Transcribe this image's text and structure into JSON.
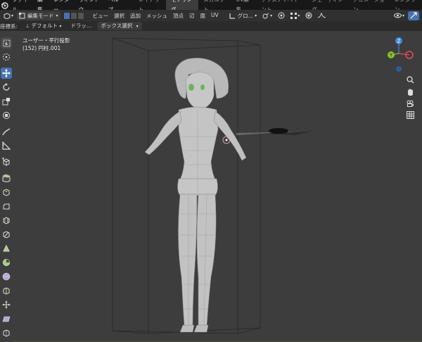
{
  "menu": {
    "items": [
      "ファイル",
      "編集",
      "レンダー",
      "ウィンドウ",
      "ヘルプ"
    ]
  },
  "workspaces": {
    "tabs": [
      "レイアウト",
      "モデリング",
      "スカルプト",
      "UV編集",
      "テクスチャペイント",
      "シェーディング",
      "アニメーション",
      "レンダリン"
    ],
    "active_index": 1
  },
  "header": {
    "mode": "編集モード",
    "menus": [
      "ビュー",
      "選択",
      "追加",
      "メッシュ",
      "頂点",
      "辺",
      "面",
      "UV"
    ],
    "transform_orientation": "グロ…"
  },
  "tool_settings": {
    "orientation_label": "座標系:",
    "orientation_value": "デフォルト",
    "drag_label": "ドラッ…",
    "drag_value": "ボックス選択"
  },
  "viewport": {
    "view_name": "ユーザー・平行投影",
    "object_info": "(152) 円柱.001"
  },
  "gizmo": {
    "z_label": "Z",
    "y_label": "Y",
    "x_color": "#e94b55",
    "y_color": "#8ac22a",
    "z_color": "#3f8cde"
  },
  "colors": {
    "accent": "#4772b3",
    "viewport_bg": "#3d3d3d",
    "header_bg": "#303030",
    "topbar_bg": "#181818"
  },
  "left_tools": [
    "select-box",
    "cursor",
    "move",
    "rotate",
    "scale",
    "transform",
    "annotate",
    "measure",
    "add-cube",
    "extrude",
    "inset",
    "bevel",
    "loop-cut",
    "knife",
    "poly-build",
    "spin",
    "smooth",
    "edge-slide",
    "shrink-fatten",
    "shear",
    "rip"
  ],
  "right_nav": [
    "zoom",
    "pan",
    "camera",
    "grid"
  ]
}
